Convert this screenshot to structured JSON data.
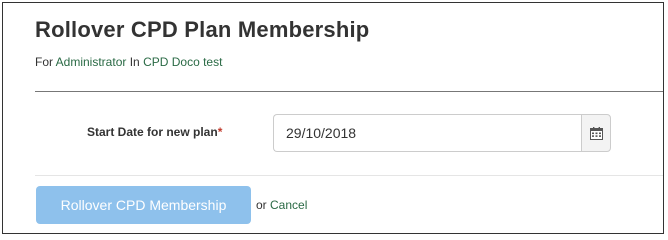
{
  "page": {
    "title": "Rollover CPD Plan Membership",
    "subtitle": {
      "prefix": "For",
      "user": "Administrator",
      "in_word": "In",
      "plan": "CPD Doco test"
    }
  },
  "form": {
    "start_date": {
      "label": "Start Date for new plan",
      "required_marker": "*",
      "value": "29/10/2018"
    }
  },
  "actions": {
    "submit_label": "Rollover CPD Membership",
    "submit_enabled": false,
    "or_text": "or",
    "cancel_label": "Cancel"
  },
  "colors": {
    "link": "#2a6a45",
    "button_disabled": "#8ec1ec",
    "required": "#c0392b"
  },
  "icons": {
    "date_picker": "calendar-icon"
  }
}
